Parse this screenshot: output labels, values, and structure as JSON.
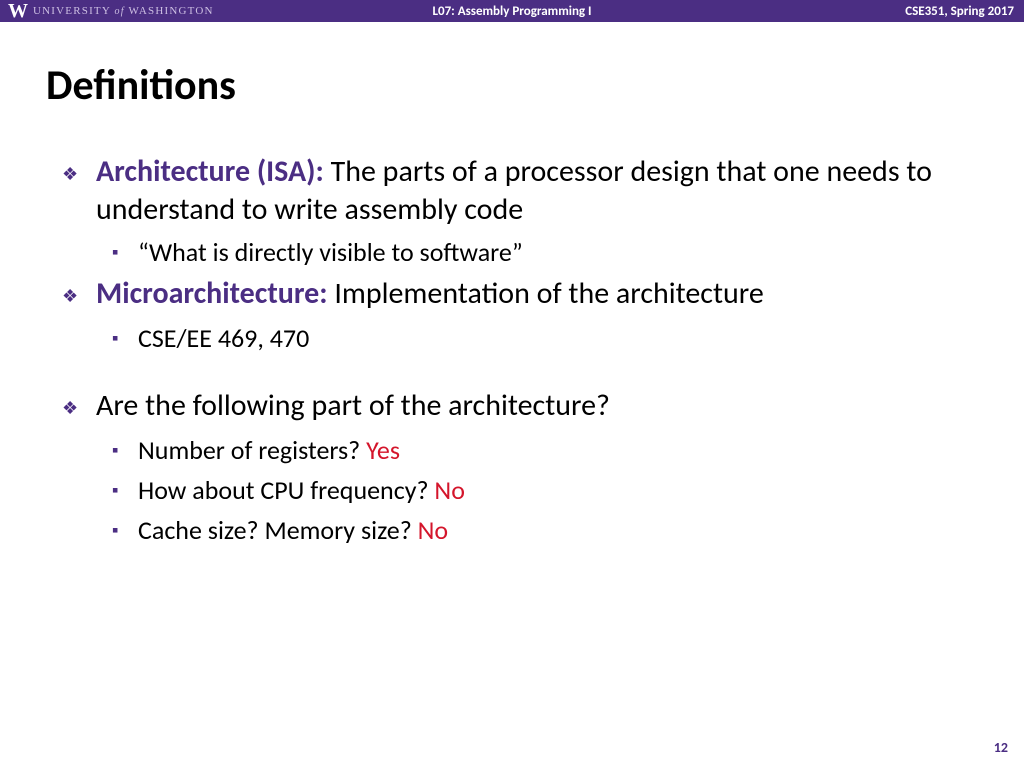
{
  "header": {
    "university_part1": "UNIVERSITY",
    "university_of": "of",
    "university_part2": "WASHINGTON",
    "lecture": "L07: Assembly Programming I",
    "course": "CSE351, Spring 2017"
  },
  "title": "Definitions",
  "bullets": {
    "arch_term": "Architecture (ISA):",
    "arch_rest": "  The parts of a processor design that one needs to understand to write assembly code",
    "arch_sub1": "“What is directly visible to software”",
    "micro_term": "Microarchitecture:",
    "micro_rest": "  Implementation of the architecture",
    "micro_sub1": "CSE/EE 469, 470",
    "q_main": "Are the following part of the architecture?",
    "q1_text": "Number of registers? ",
    "q1_ans": "Yes",
    "q2_text": "How about CPU frequency? ",
    "q2_ans": "No",
    "q3_text": "Cache size? Memory size? ",
    "q3_ans": "No"
  },
  "page_number": "12"
}
